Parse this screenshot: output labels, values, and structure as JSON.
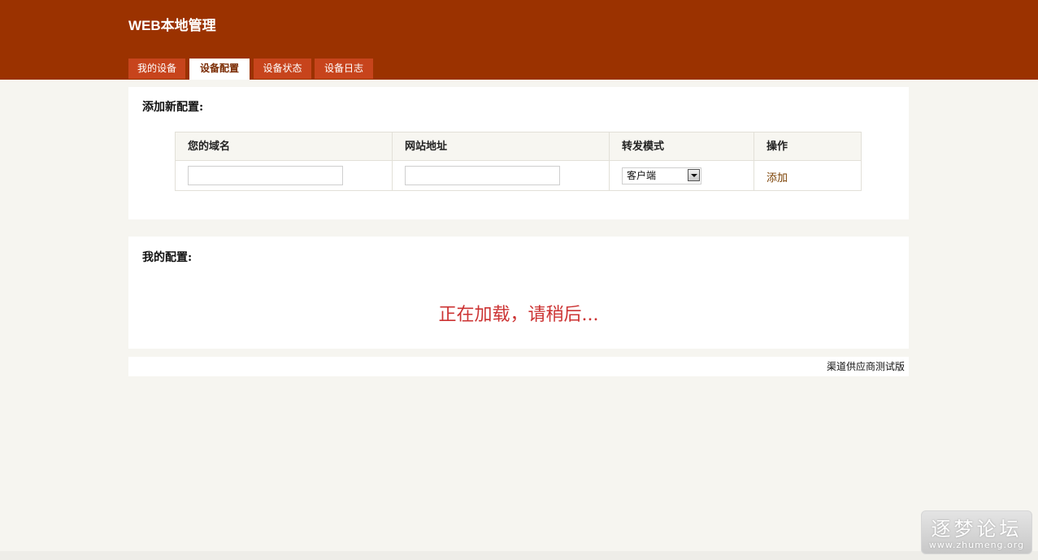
{
  "header": {
    "title": "WEB本地管理",
    "bg_color": "#9b3200"
  },
  "tabs": [
    {
      "label": "我的设备",
      "active": false
    },
    {
      "label": "设备配置",
      "active": true
    },
    {
      "label": "设备状态",
      "active": false
    },
    {
      "label": "设备日志",
      "active": false
    }
  ],
  "add_config": {
    "title": "添加新配置:",
    "columns": [
      "您的域名",
      "网站地址",
      "转发模式",
      "操作"
    ],
    "domain_input": {
      "value": ""
    },
    "url_input": {
      "value": ""
    },
    "mode_select": {
      "selected": "客户端"
    },
    "action_label": "添加"
  },
  "my_config": {
    "title": "我的配置:",
    "loading_text": "正在加载，请稍后..."
  },
  "footer": {
    "text": "渠道供应商测试版"
  },
  "watermark": {
    "title": "逐梦论坛",
    "url": "www.zhumeng.org"
  },
  "colors": {
    "accent": "#9b3200",
    "tab": "#c7441c",
    "loading": "#cc3333",
    "page_bg": "#f6f5f0"
  }
}
